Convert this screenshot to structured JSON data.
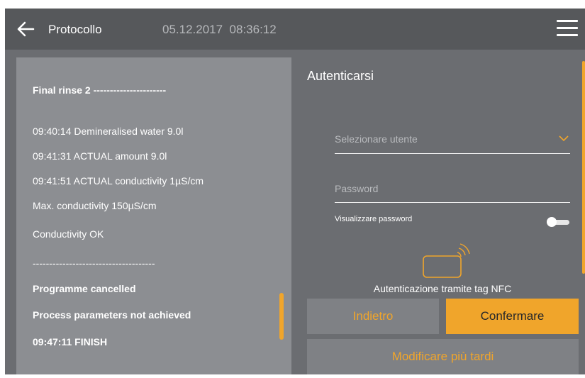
{
  "header": {
    "title": "Protocollo",
    "date": "05.12.2017",
    "time": "08:36:12"
  },
  "log": {
    "lines": [
      {
        "text": "Final rinse 2 ----------------------",
        "bold": true
      },
      {
        "text": "09:40:14 Demineralised water 9.0l",
        "bold": false
      },
      {
        "text": "09:41:31 ACTUAL amount 9.0l",
        "bold": false
      },
      {
        "text": "09:41:51 ACTUAL conductivity 1µS/cm",
        "bold": false
      },
      {
        "text": "Max. conductivity 150µS/cm",
        "bold": false
      },
      {
        "text": "Conductivity OK",
        "bold": false
      },
      {
        "text": "-------------------------------------",
        "bold": false
      },
      {
        "text": "Programme cancelled",
        "bold": true
      },
      {
        "text": "Process parameters not achieved",
        "bold": true
      },
      {
        "text": "09:47:11 FINISH",
        "bold": true
      }
    ]
  },
  "auth": {
    "title": "Autenticarsi",
    "user_placeholder": "Selezionare utente",
    "password_placeholder": "Password",
    "show_password_label": "Visualizzare password",
    "show_password_on": false,
    "nfc_label": "Autenticazione tramite tag NFC",
    "back_label": "Indietro",
    "confirm_label": "Confermare",
    "later_label": "Modificare più tardi"
  },
  "icons": {
    "back": "arrow-left-icon",
    "menu": "hamburger-menu-icon",
    "chevron": "chevron-down-icon",
    "nfc": "nfc-tag-icon"
  },
  "colors": {
    "accent": "#f0a52b",
    "header_bg": "#56585b",
    "panel_bg": "#8c8e92",
    "background": "#6b6d71"
  }
}
